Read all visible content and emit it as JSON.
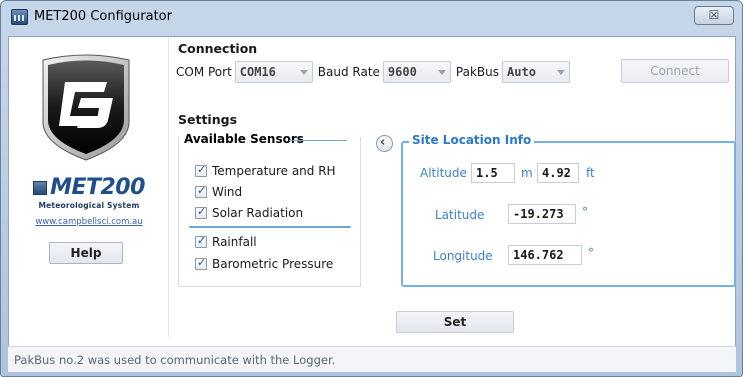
{
  "window": {
    "title": "MET200 Configurator",
    "close_label": "☒"
  },
  "brand": {
    "logo_text": "CS",
    "product": "MET200",
    "subtitle": "Meteorological System",
    "url": "www.campbellsci.com.au",
    "help_label": "Help"
  },
  "connection": {
    "title": "Connection",
    "com_label": "COM Port",
    "com_value": "COM16",
    "baud_label": "Baud Rate",
    "baud_value": "9600",
    "pakbus_label": "PakBus",
    "pakbus_value": "Auto",
    "connect_label": "Connect"
  },
  "settings": {
    "title": "Settings",
    "sensors_title": "Available Sensors",
    "sensors": [
      {
        "label": "Temperature and RH",
        "checked": true
      },
      {
        "label": "Wind",
        "checked": true
      },
      {
        "label": "Solar Radiation",
        "checked": true
      },
      {
        "label": "Rainfall",
        "checked": true
      },
      {
        "label": "Barometric Pressure",
        "checked": true
      }
    ],
    "collapse_icon": "chevron-left-icon",
    "site_title": "Site Location Info",
    "altitude_label": "Altitude",
    "altitude_m": "1.5",
    "altitude_m_unit": "m",
    "altitude_ft": "4.92",
    "altitude_ft_unit": "ft",
    "latitude_label": "Latitude",
    "latitude_value": "-19.273",
    "latitude_unit": "°",
    "longitude_label": "Longitude",
    "longitude_value": "146.762",
    "longitude_unit": "°"
  },
  "set_label": "Set",
  "status_text": "PakBus no.2 was used to communicate with the Logger.",
  "colors": {
    "accent": "#74b0e2",
    "site_text": "#2b79c9",
    "brand_blue": "#1f4e8c"
  }
}
